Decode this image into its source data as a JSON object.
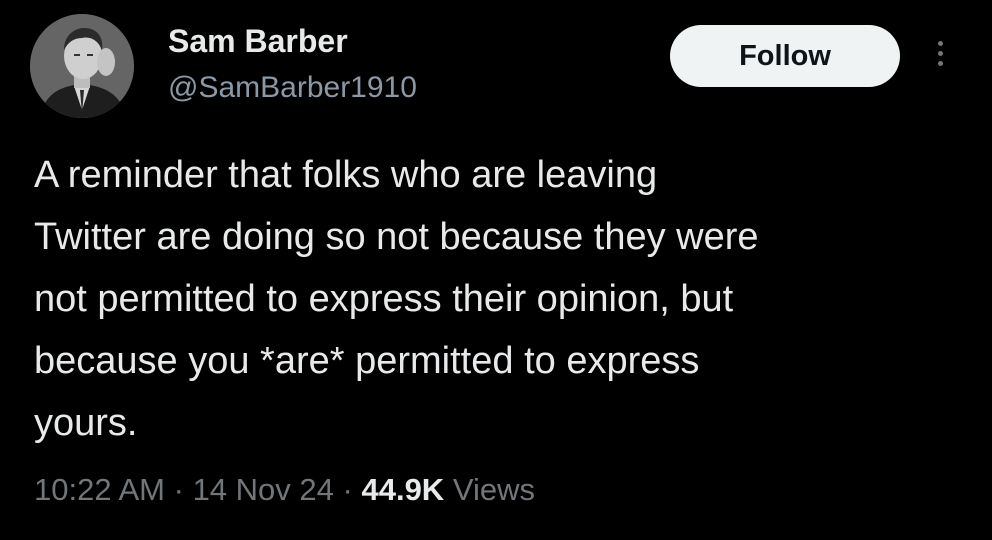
{
  "author": {
    "display_name": "Sam Barber",
    "handle": "@SamBarber1910",
    "avatar_icon": "portrait-photo"
  },
  "actions": {
    "follow_label": "Follow",
    "more_icon": "vertical-ellipsis-icon"
  },
  "tweet": {
    "text_lines": [
      "A reminder that folks who are leaving",
      "Twitter are doing so not because they were",
      "not permitted to express their opinion, but",
      "because you *are* permitted to express",
      "yours."
    ]
  },
  "meta": {
    "time": "10:22 AM",
    "separator": "·",
    "date": "14 Nov 24",
    "views_count": "44.9K",
    "views_label": "Views"
  },
  "colors": {
    "background": "#000000",
    "primary_text": "#e7e9ea",
    "secondary_text": "#71767b",
    "follow_button_bg": "#eff3f4"
  }
}
